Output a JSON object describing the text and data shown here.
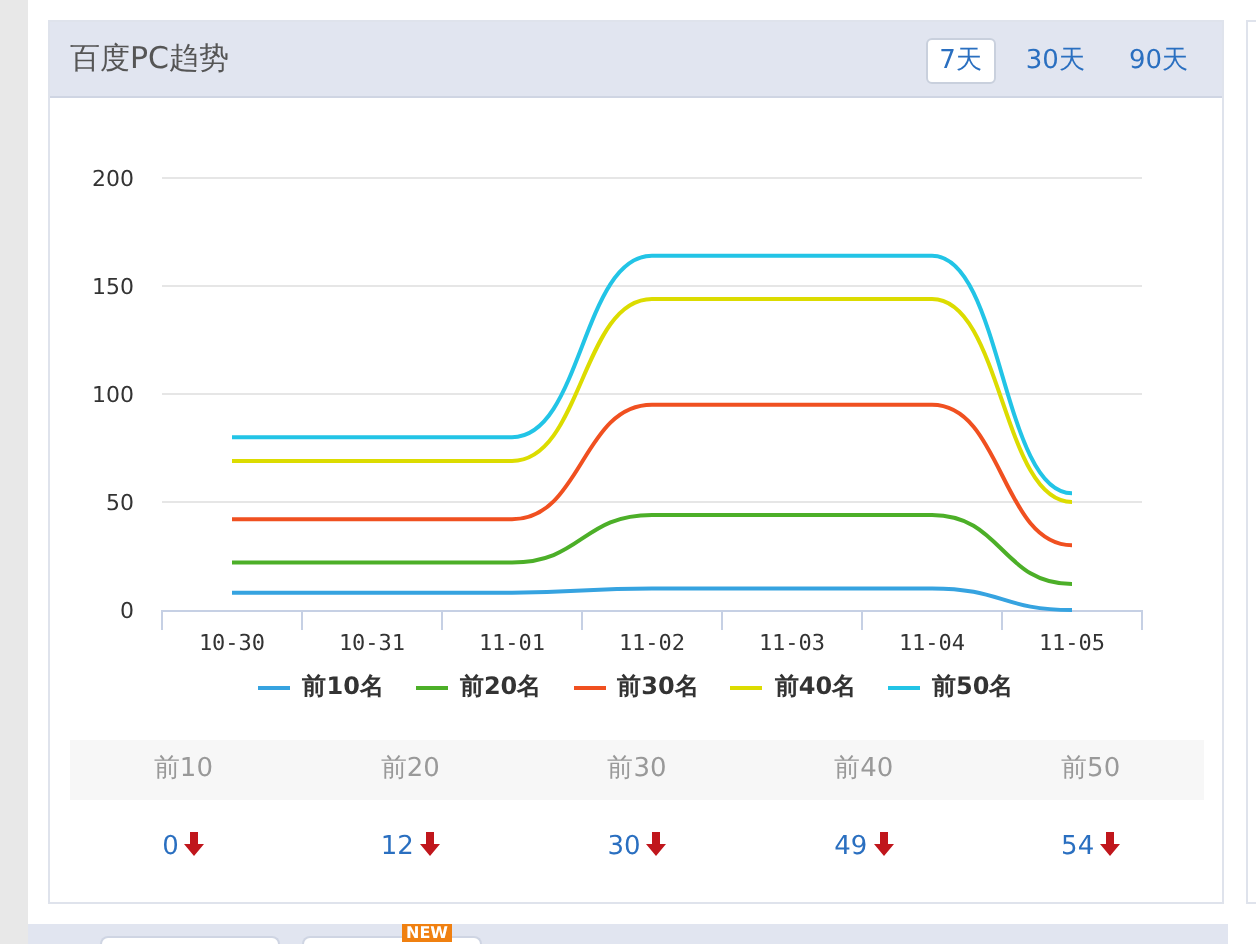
{
  "panel": {
    "title": "百度PC趋势",
    "ranges": [
      {
        "label": "7天",
        "selected": true
      },
      {
        "label": "30天",
        "selected": false
      },
      {
        "label": "90天",
        "selected": false
      }
    ]
  },
  "chart_data": {
    "type": "line",
    "categories": [
      "10-30",
      "10-31",
      "11-01",
      "11-02",
      "11-03",
      "11-04",
      "11-05"
    ],
    "ylim": [
      0,
      200
    ],
    "grid": true,
    "yticks": [
      0,
      50,
      100,
      150,
      200
    ],
    "series": [
      {
        "name": "前10名",
        "color": "#36a3e0",
        "values": [
          8,
          8,
          8,
          10,
          10,
          10,
          0
        ]
      },
      {
        "name": "前20名",
        "color": "#4caf28",
        "values": [
          22,
          22,
          22,
          44,
          44,
          44,
          12
        ]
      },
      {
        "name": "前30名",
        "color": "#f05020",
        "values": [
          42,
          42,
          42,
          95,
          95,
          95,
          30
        ]
      },
      {
        "name": "前40名",
        "color": "#dcdc00",
        "values": [
          69,
          69,
          69,
          144,
          144,
          144,
          50
        ]
      },
      {
        "name": "前50名",
        "color": "#22c4e6",
        "values": [
          80,
          80,
          80,
          164,
          164,
          164,
          54
        ]
      }
    ]
  },
  "stats": [
    {
      "label": "前10",
      "value": "0",
      "falling": true
    },
    {
      "label": "前20",
      "value": "12",
      "falling": true
    },
    {
      "label": "前30",
      "value": "30",
      "falling": true
    },
    {
      "label": "前40",
      "value": "49",
      "falling": true
    },
    {
      "label": "前50",
      "value": "54",
      "falling": true
    }
  ],
  "bottom_bar": {
    "badge": "NEW"
  }
}
